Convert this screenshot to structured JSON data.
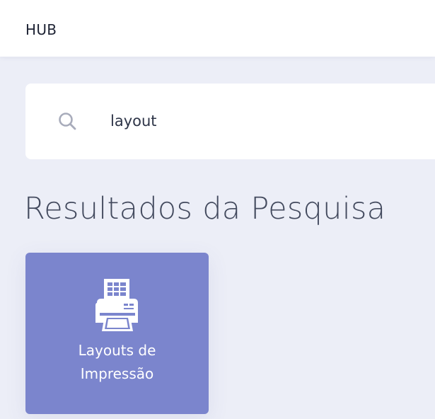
{
  "header": {
    "brand": "HUB"
  },
  "search": {
    "value": "layout",
    "icon": "search-icon"
  },
  "results": {
    "title": "Resultados da Pesquisa",
    "items": [
      {
        "label_line1": "Layouts de",
        "label_line2": "Impressão",
        "icon": "printer-icon",
        "color": "#7b85cd"
      }
    ]
  },
  "colors": {
    "background": "#eceef7",
    "card": "#7b85cd",
    "title_text": "#434a5e"
  }
}
